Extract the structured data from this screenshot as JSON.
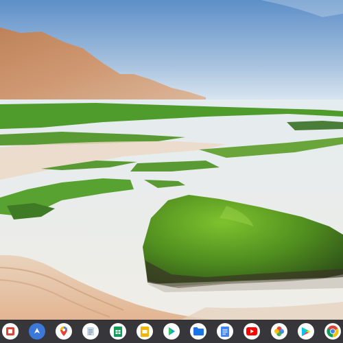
{
  "desktop": {
    "wallpaper_description_name": "coastal-wallpaper"
  },
  "shelf": {
    "apps": [
      {
        "name": "launcher",
        "icon": "launcher-icon",
        "bg": "#ffffff"
      },
      {
        "name": "explore",
        "icon": "explore-icon",
        "bg": "#3c78d8"
      },
      {
        "name": "maps",
        "icon": "maps-icon",
        "bg": "#ffffff"
      },
      {
        "name": "notepad",
        "icon": "notepad-icon",
        "bg": "#ffffff"
      },
      {
        "name": "sheets",
        "icon": "sheets-icon",
        "bg": "#ffffff"
      },
      {
        "name": "slides",
        "icon": "slides-icon",
        "bg": "#ffffff"
      },
      {
        "name": "play-movies",
        "icon": "play-movies-icon",
        "bg": "#ffffff"
      },
      {
        "name": "files",
        "icon": "files-icon",
        "bg": "#ffffff"
      },
      {
        "name": "docs",
        "icon": "docs-icon",
        "bg": "#ffffff"
      },
      {
        "name": "youtube",
        "icon": "youtube-icon",
        "bg": "#ffffff"
      },
      {
        "name": "photos",
        "icon": "photos-icon",
        "bg": "#ffffff"
      },
      {
        "name": "play-store",
        "icon": "play-store-icon",
        "bg": "#ffffff"
      },
      {
        "name": "chrome",
        "icon": "chrome-icon",
        "bg": "#ffffff"
      }
    ]
  }
}
